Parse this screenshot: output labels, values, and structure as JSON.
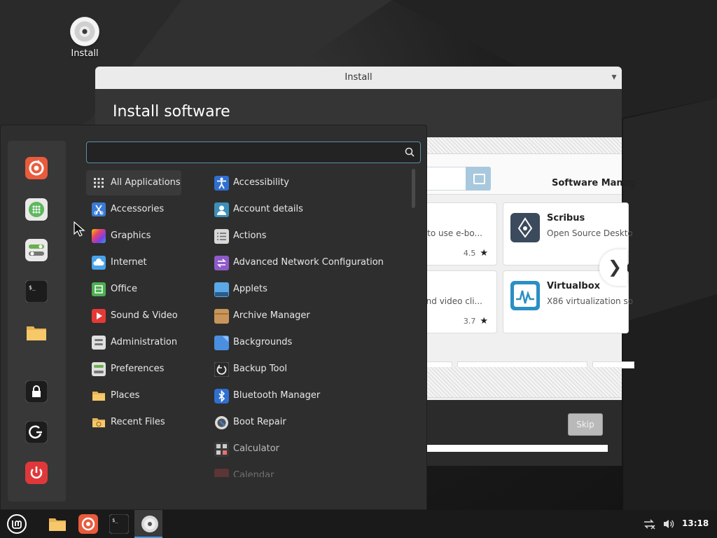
{
  "desktop": {
    "icon_label": "Install"
  },
  "install_window": {
    "title": "Install",
    "heading": "Install software",
    "skip_label": "Skip",
    "progress": 1.0
  },
  "software_manager": {
    "title": "Software Manag",
    "cards": [
      {
        "name": "",
        "desc": "asy to use e-bo...",
        "rating": "4.5"
      },
      {
        "name": "Scribus",
        "desc": "Open Source Deskto"
      },
      {
        "name": "",
        "desc": "e and video cli...",
        "rating": "3.7"
      },
      {
        "name": "Virtualbox",
        "desc": "X86 virtualization so"
      }
    ]
  },
  "menu": {
    "search": {
      "value": "",
      "placeholder": ""
    },
    "categories": [
      {
        "label": "All Applications",
        "icon": "grid-icon",
        "selected": true
      },
      {
        "label": "Accessories",
        "icon": "scissors-icon"
      },
      {
        "label": "Graphics",
        "icon": "graphics-icon"
      },
      {
        "label": "Internet",
        "icon": "cloud-icon"
      },
      {
        "label": "Office",
        "icon": "office-icon"
      },
      {
        "label": "Sound & Video",
        "icon": "play-icon"
      },
      {
        "label": "Administration",
        "icon": "admin-icon"
      },
      {
        "label": "Preferences",
        "icon": "toggles-icon"
      },
      {
        "label": "Places",
        "icon": "folder-icon"
      },
      {
        "label": "Recent Files",
        "icon": "recent-folder-icon"
      }
    ],
    "apps": [
      {
        "label": "Accessibility",
        "icon": "accessibility-icon"
      },
      {
        "label": "Account details",
        "icon": "account-icon"
      },
      {
        "label": "Actions",
        "icon": "actions-icon"
      },
      {
        "label": "Advanced Network Configuration",
        "icon": "network-icon"
      },
      {
        "label": "Applets",
        "icon": "applets-icon"
      },
      {
        "label": "Archive Manager",
        "icon": "archive-icon"
      },
      {
        "label": "Backgrounds",
        "icon": "backgrounds-icon"
      },
      {
        "label": "Backup Tool",
        "icon": "backup-icon"
      },
      {
        "label": "Bluetooth Manager",
        "icon": "bluetooth-icon"
      },
      {
        "label": "Boot Repair",
        "icon": "boot-repair-icon"
      },
      {
        "label": "Calculator",
        "icon": "calculator-icon"
      },
      {
        "label": "Calendar",
        "icon": "calendar-icon"
      }
    ],
    "favorites": [
      "firefox-icon",
      "software-manager-icon",
      "settings-icon",
      "terminal-icon",
      "files-icon",
      "lock-icon",
      "logout-icon",
      "power-icon"
    ]
  },
  "taskbar": {
    "clock": "13:18",
    "items": [
      "mint-menu-icon",
      "files-icon",
      "firefox-icon",
      "terminal-icon",
      "install-disc-icon"
    ]
  },
  "colors": {
    "accent": "#4a9ae0",
    "menu_bg": "#2e2e2e",
    "firefox": "#e95b3c",
    "power": "#e0383a"
  }
}
